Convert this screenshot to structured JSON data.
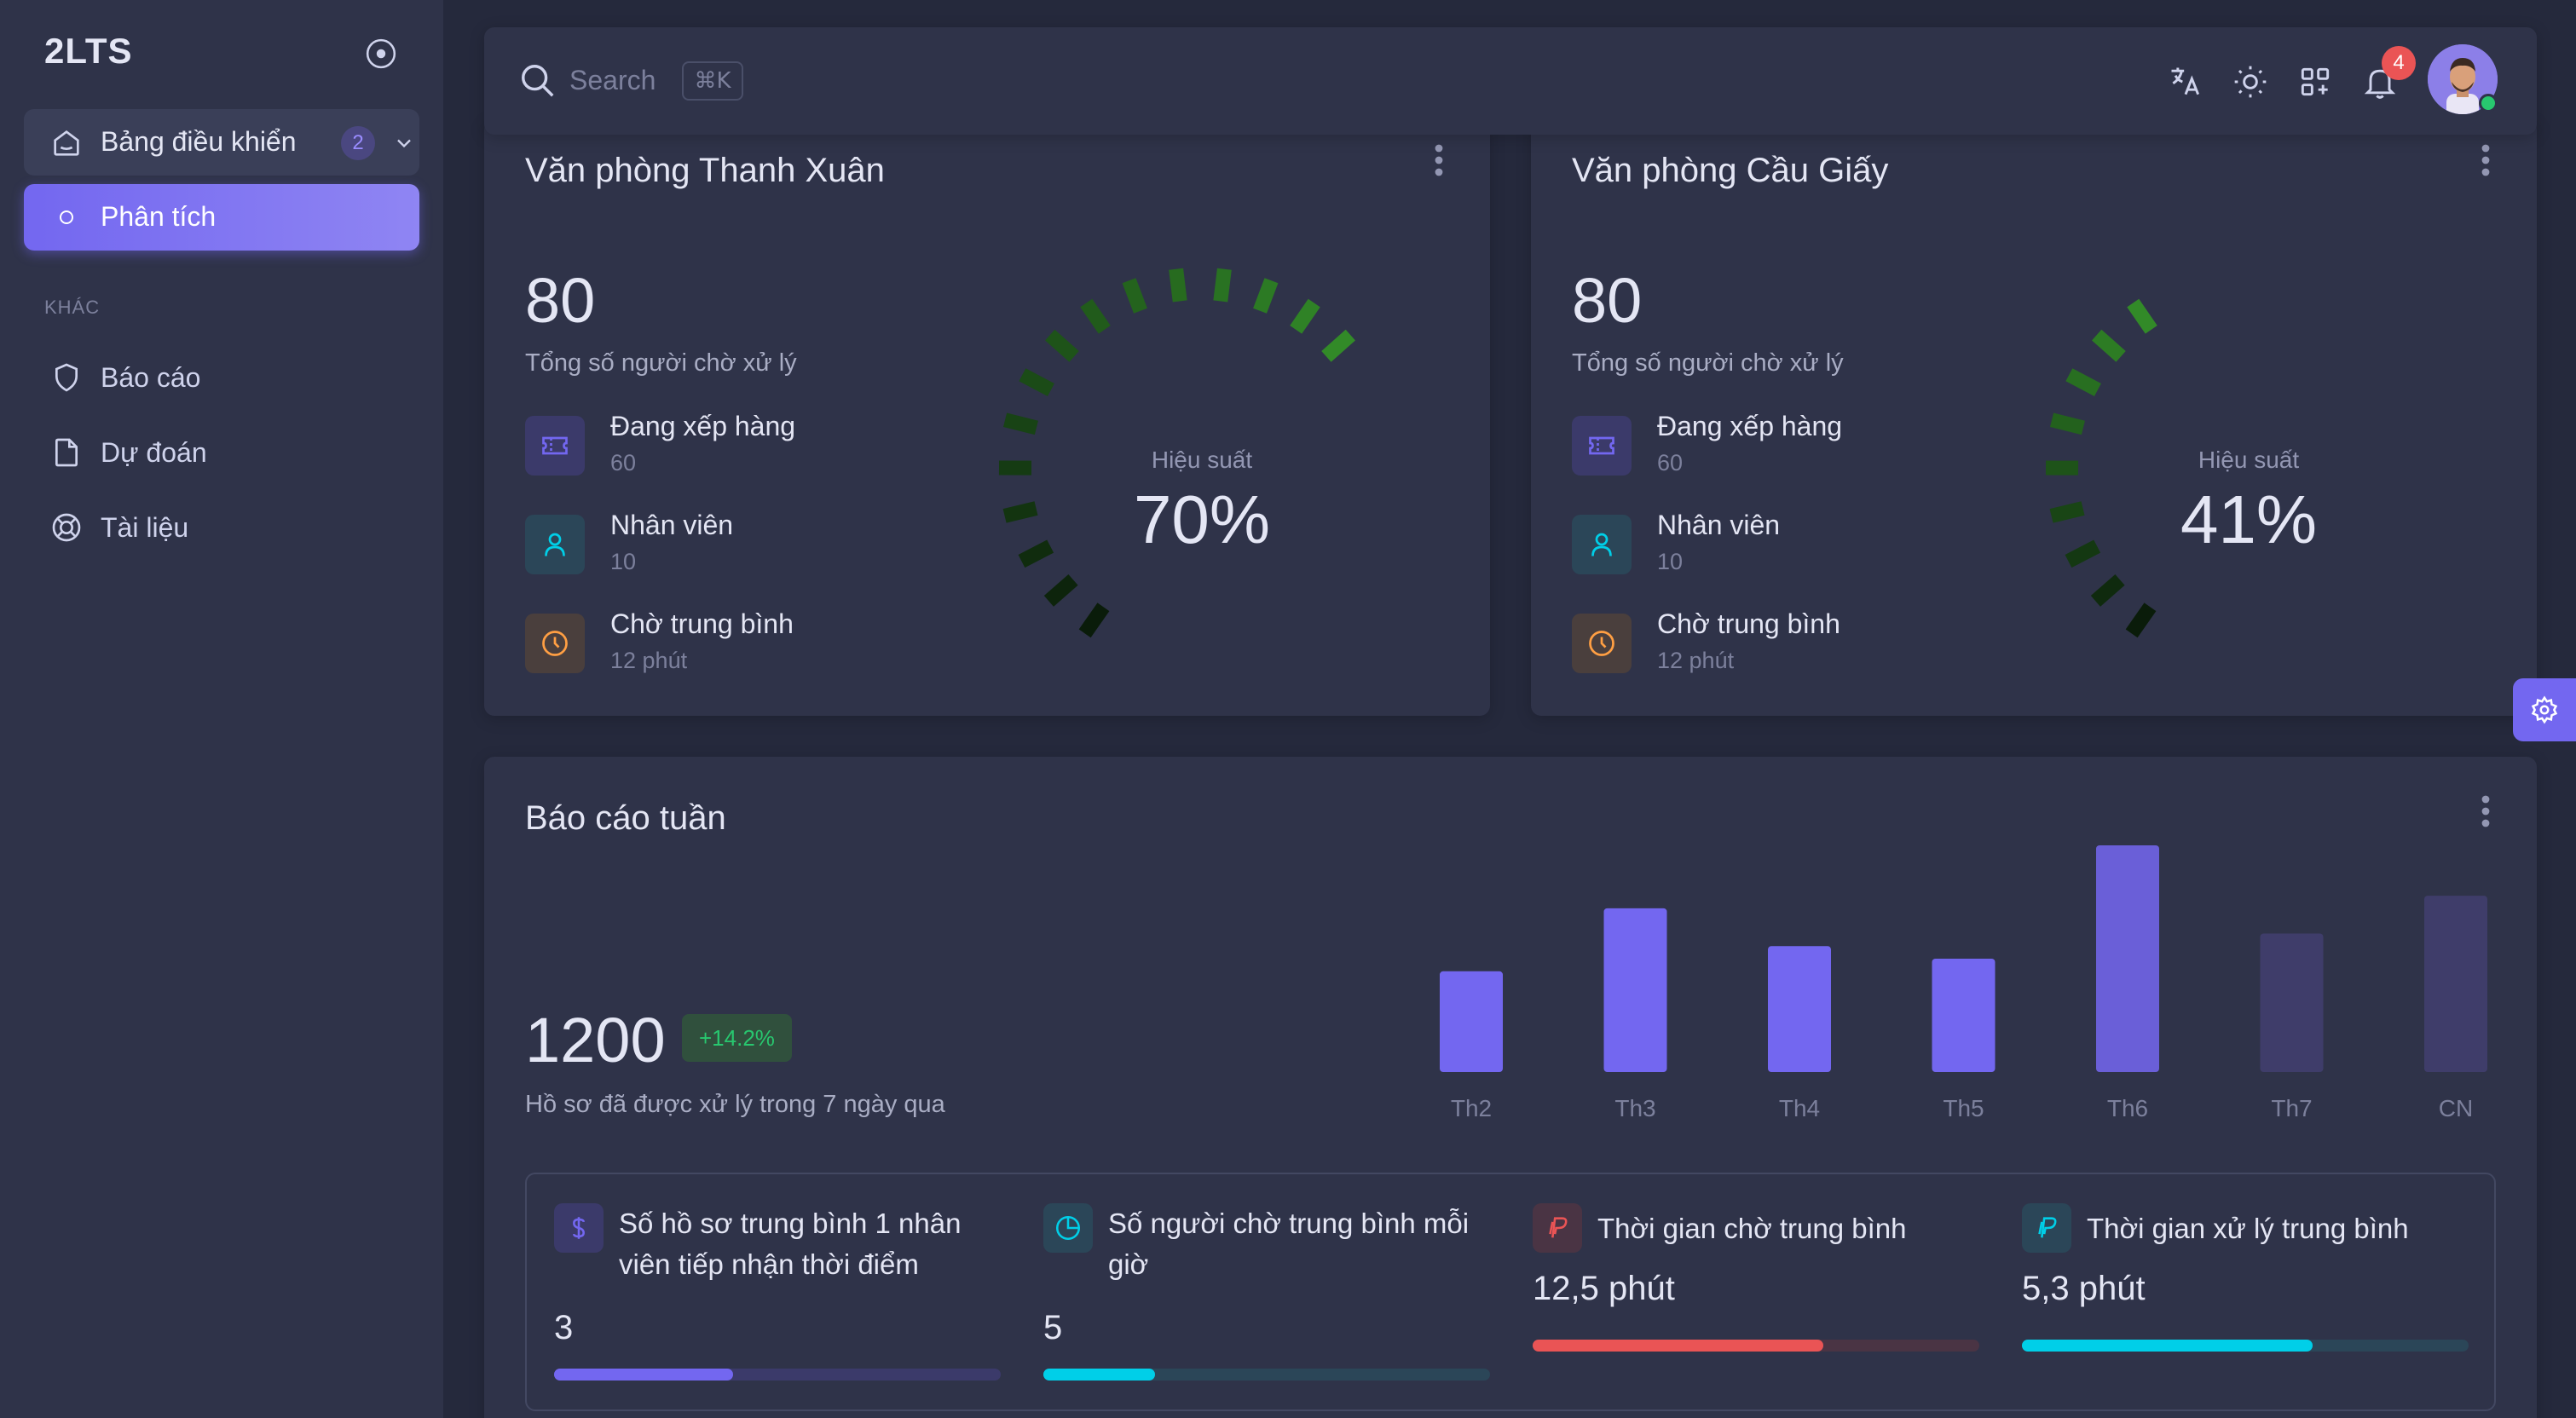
{
  "brand": {
    "name": "2LTS"
  },
  "sidebar": {
    "group": {
      "label": "Bảng điều khiển",
      "badge": "2"
    },
    "active_item": {
      "label": "Phân tích"
    },
    "section_title": "KHÁC",
    "items": [
      {
        "label": "Báo cáo",
        "icon": "shield-icon"
      },
      {
        "label": "Dự đoán",
        "icon": "file-icon"
      },
      {
        "label": "Tài liệu",
        "icon": "lifebuoy-icon"
      }
    ]
  },
  "topbar": {
    "search_placeholder": "Search",
    "shortcut": "⌘K",
    "notification_count": "4"
  },
  "offices": [
    {
      "title": "Văn phòng Thanh Xuân",
      "total": "80",
      "total_label": "Tổng số người chờ xử lý",
      "stats": [
        {
          "label": "Đang xếp hàng",
          "value": "60",
          "icon": "ticket-icon",
          "color": "#7367f0"
        },
        {
          "label": "Nhân viên",
          "value": "10",
          "icon": "user-icon",
          "color": "#00cfe8"
        },
        {
          "label": "Chờ trung bình",
          "value": "12 phút",
          "icon": "clock-icon",
          "color": "#ff9f43"
        }
      ],
      "performance_label": "Hiệu suất",
      "performance_value": "70%",
      "performance_fraction": 0.7
    },
    {
      "title": "Văn phòng Cầu Giấy",
      "total": "80",
      "total_label": "Tổng số người chờ xử lý",
      "stats": [
        {
          "label": "Đang xếp hàng",
          "value": "60",
          "icon": "ticket-icon",
          "color": "#7367f0"
        },
        {
          "label": "Nhân viên",
          "value": "10",
          "icon": "user-icon",
          "color": "#00cfe8"
        },
        {
          "label": "Chờ trung bình",
          "value": "12 phút",
          "icon": "clock-icon",
          "color": "#ff9f43"
        }
      ],
      "performance_label": "Hiệu suất",
      "performance_value": "41%",
      "performance_fraction": 0.41
    }
  ],
  "weekly": {
    "title": "Báo cáo tuần",
    "total": "1200",
    "change": "+14.2%",
    "subtitle": "Hồ sơ đã được xử lý trong 7 ngày qua",
    "metrics": [
      {
        "label": "Số hồ sơ trung bình 1 nhân viên tiếp nhận thời điểm",
        "value": "3",
        "icon": "dollar-icon",
        "color": "#7367f0",
        "progress": 0.4
      },
      {
        "label": "Số người chờ trung bình mỗi giờ",
        "value": "5",
        "icon": "pie-chart-icon",
        "color": "#00cfe8",
        "progress": 0.25
      },
      {
        "label": "Thời gian chờ trung bình",
        "value": "12,5 phút",
        "icon": "paypal-icon",
        "color": "#ea5455",
        "progress": 0.65
      },
      {
        "label": "Thời gian xử lý trung bình",
        "value": "5,3 phút",
        "icon": "paypal-icon",
        "color": "#00cfe8",
        "progress": 0.65
      }
    ]
  },
  "chart_data": {
    "type": "bar",
    "categories": [
      "Th2",
      "Th3",
      "Th4",
      "Th5",
      "Th6",
      "Th7",
      "CN"
    ],
    "values": [
      40,
      65,
      50,
      45,
      90,
      55,
      70
    ],
    "colors": [
      "#7367f0",
      "#7367f0",
      "#7367f0",
      "#7367f0",
      "#6a5fd8",
      "#3f3d6a",
      "#3f3d6a"
    ],
    "ylim": [
      0,
      90
    ],
    "grid": false,
    "title": "",
    "xlabel": "",
    "ylabel": ""
  },
  "colors": {
    "accent": "#7367f0",
    "success": "#28c76f",
    "danger": "#ea5455",
    "info": "#00cfe8",
    "warning": "#ff9f43"
  }
}
